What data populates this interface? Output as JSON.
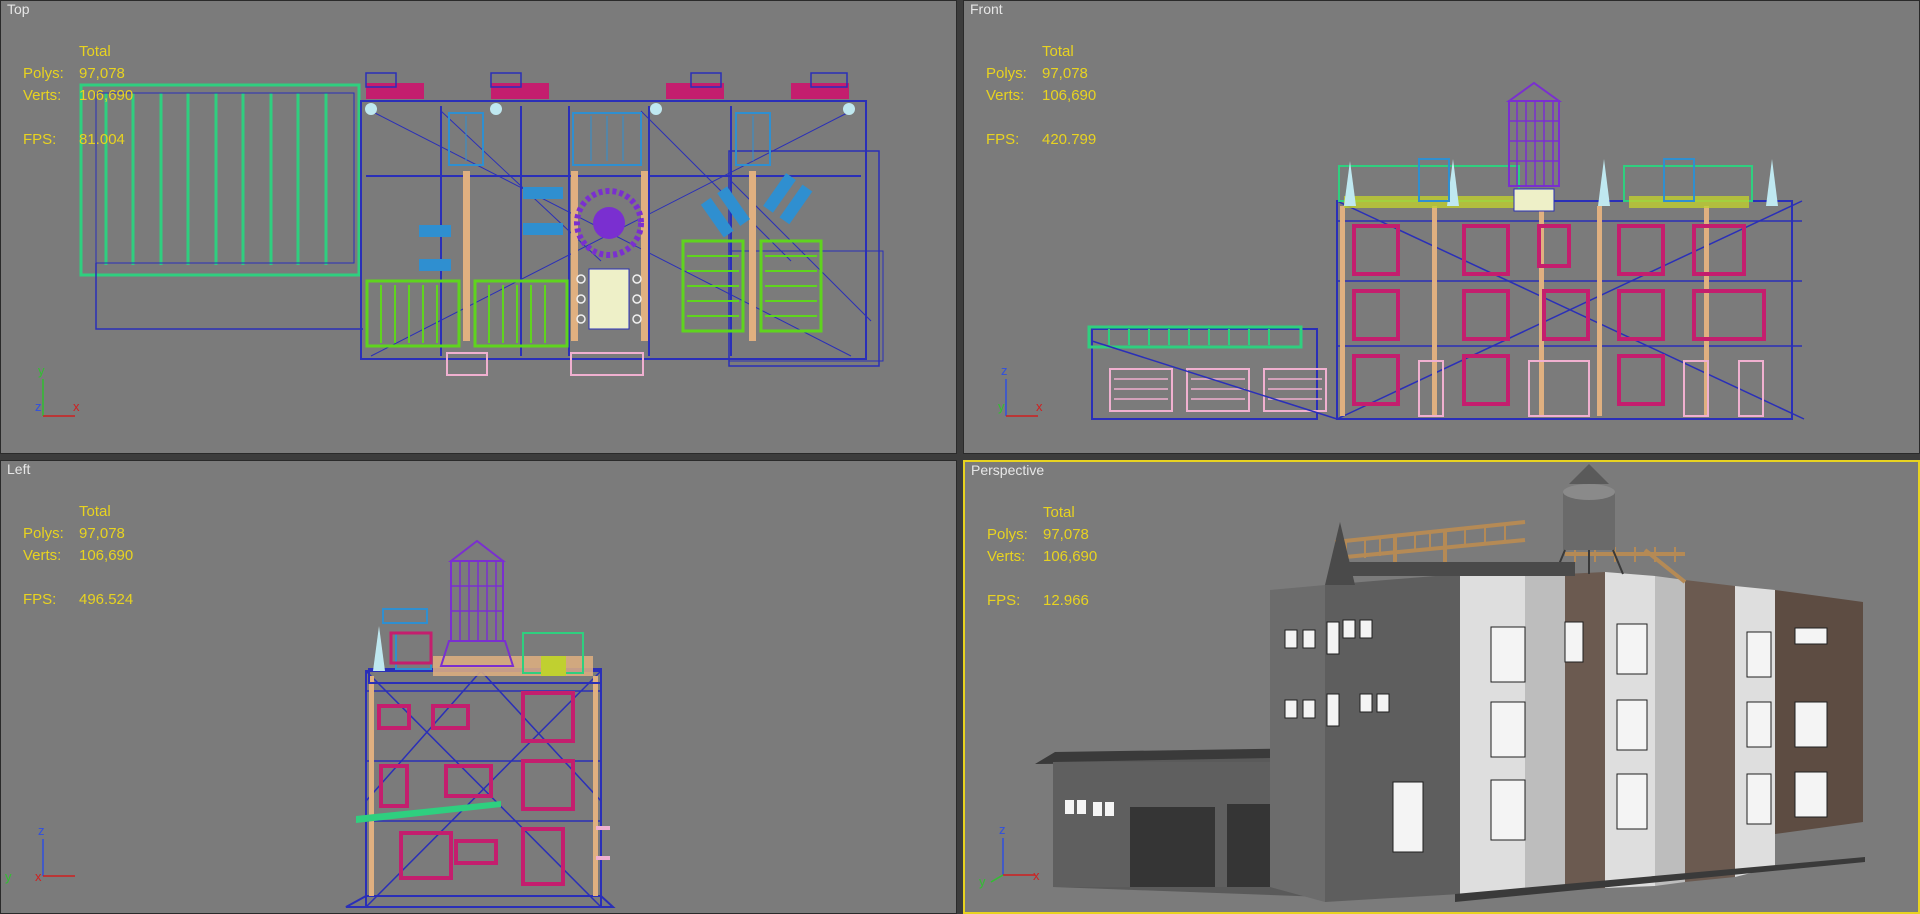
{
  "viewports": {
    "top": {
      "label": "Top",
      "stats_header": "Total",
      "polys_label": "Polys:",
      "polys": "97,078",
      "verts_label": "Verts:",
      "verts": "106,690",
      "fps_label": "FPS:",
      "fps": "81.004",
      "axes": {
        "h": "x",
        "v": "y",
        "o": "z"
      }
    },
    "front": {
      "label": "Front",
      "stats_header": "Total",
      "polys_label": "Polys:",
      "polys": "97,078",
      "verts_label": "Verts:",
      "verts": "106,690",
      "fps_label": "FPS:",
      "fps": "420.799",
      "axes": {
        "h": "x",
        "v": "z",
        "o": "y"
      }
    },
    "left": {
      "label": "Left",
      "stats_header": "Total",
      "polys_label": "Polys:",
      "polys": "97,078",
      "verts_label": "Verts:",
      "verts": "106,690",
      "fps_label": "FPS:",
      "fps": "496.524",
      "axes": {
        "h": "x",
        "v": "z",
        "o": "y"
      }
    },
    "persp": {
      "label": "Perspective",
      "stats_header": "Total",
      "polys_label": "Polys:",
      "polys": "97,078",
      "verts_label": "Verts:",
      "verts": "106,690",
      "fps_label": "FPS:",
      "fps": "12.966",
      "axes": {
        "h": "x",
        "v": "z",
        "o": "y"
      }
    }
  },
  "colors": {
    "viewport_bg": "#7b7b7b",
    "stats_text": "#e8d320",
    "active_border": "#e8d320",
    "wire_blue": "#2a2fb8",
    "wire_magenta": "#c41e6e",
    "wire_green": "#2fcf7f",
    "wire_lime": "#5fd41e",
    "wire_purple": "#7a2fd0",
    "wire_cyan": "#2f8fd0",
    "wire_tan": "#e0b080",
    "wire_pink": "#f0b0d0"
  }
}
